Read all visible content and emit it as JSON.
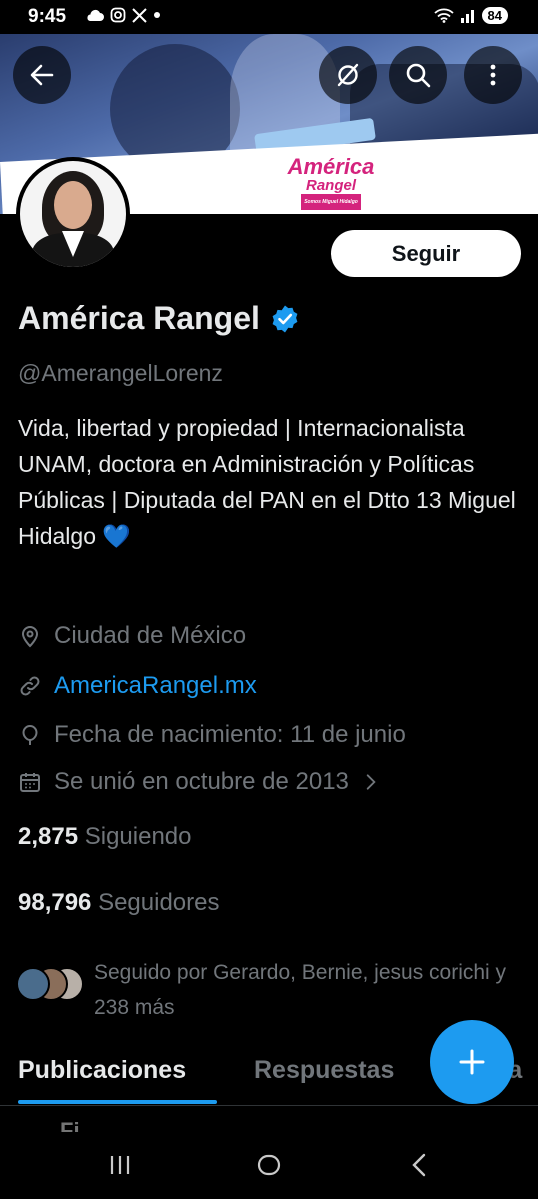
{
  "status_bar": {
    "time": "9:45",
    "left_icons": [
      "cloud-icon",
      "instagram-icon",
      "x-logo-icon",
      "dot-icon"
    ],
    "right_icons": [
      "wifi-icon",
      "signal-icon"
    ],
    "battery": "84"
  },
  "header": {
    "back_icon": "arrow-left-icon",
    "grok_icon": "grok-icon",
    "search_icon": "search-icon",
    "more_icon": "more-vertical-icon",
    "banner_logo_line1": "América",
    "banner_logo_line2": "Rangel",
    "banner_logo_sub": "Somos Miguel Hidalgo"
  },
  "profile": {
    "name": "América Rangel",
    "handle": "@AmerangelLorenz",
    "bio": "Vida, libertad y propiedad | Internacionalista UNAM, doctora en Administración y Políticas Públicas | Diputada del PAN en el Dtto 13 Miguel Hidalgo",
    "bio_emoji": "💙",
    "follow_label": "Seguir",
    "location": "Ciudad de México",
    "website": "AmericaRangel.mx",
    "birthday": "Fecha de nacimiento: 11 de junio",
    "joined": "Se unió en octubre de 2013",
    "following_count": "2,875",
    "following_label": "Siguiendo",
    "followers_count": "98,796",
    "followers_label": "Seguidores",
    "followed_by": "Seguido por Gerardo, Bernie, jesus corichi y 238 más"
  },
  "tabs": [
    {
      "label": "Publicaciones",
      "active": true
    },
    {
      "label": "Respuestas",
      "active": false
    },
    {
      "label": "ta",
      "active": false
    }
  ],
  "peek_text": "Fi",
  "colors": {
    "accent": "#1d9bf0",
    "background": "#000000",
    "primary_text": "#e7e9ea",
    "secondary_text": "#71767b",
    "brand_pink": "#d4237d"
  }
}
